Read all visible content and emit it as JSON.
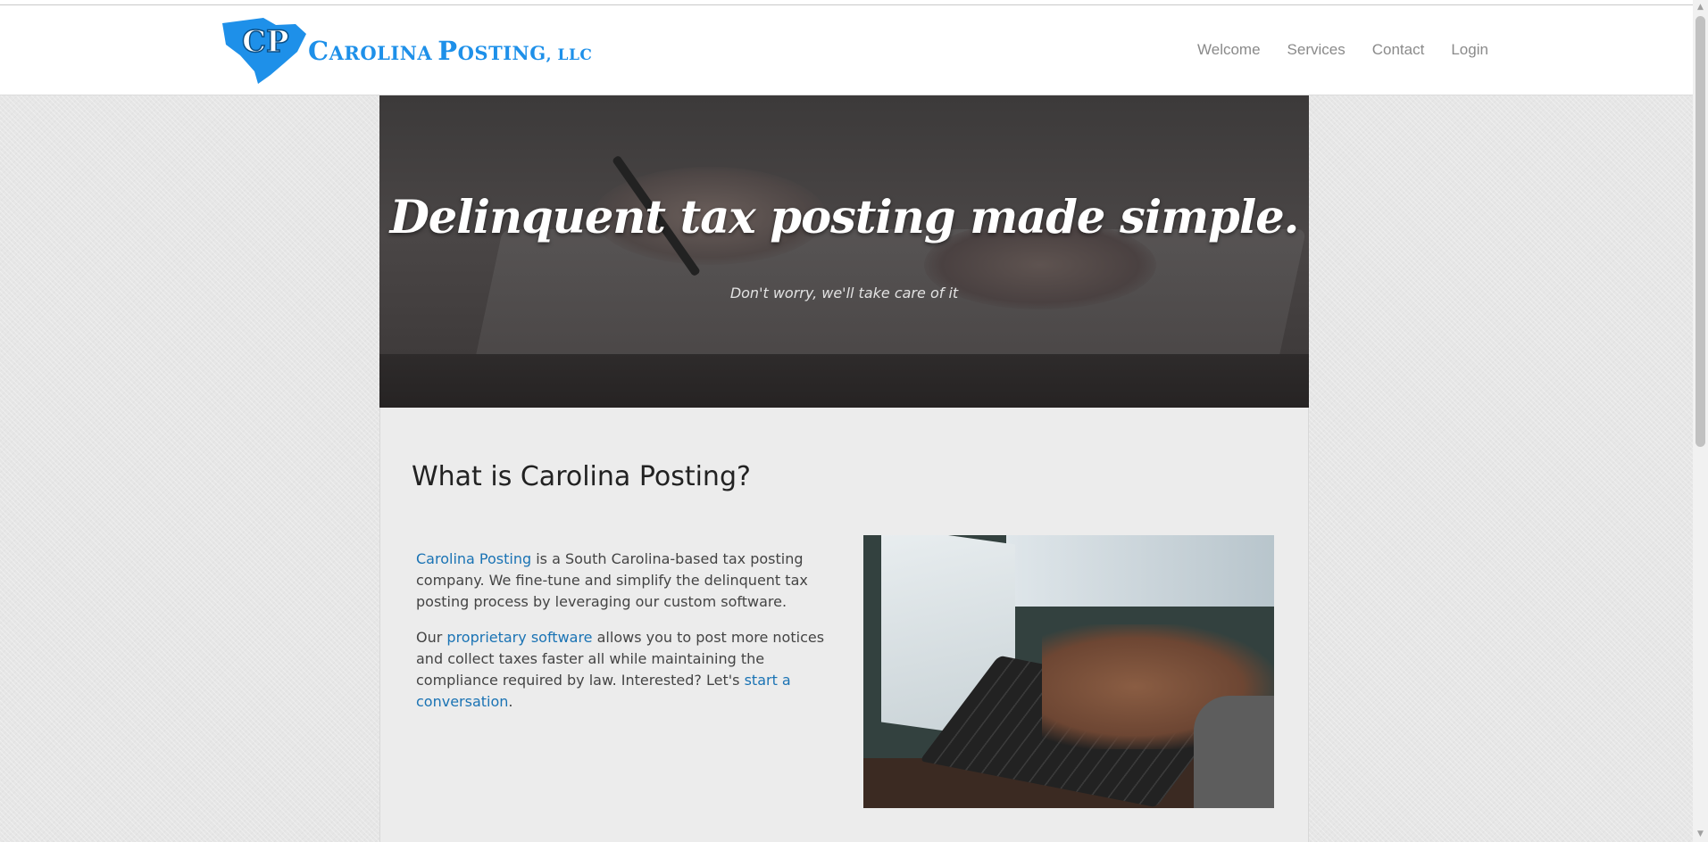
{
  "header": {
    "logo_initials": "CP",
    "logo_big_c": "C",
    "logo_word1": "AROLINA",
    "logo_big_p": "P",
    "logo_word2": "OSTING",
    "logo_llc": ", LLC",
    "nav": [
      {
        "label": "Welcome"
      },
      {
        "label": "Services"
      },
      {
        "label": "Contact"
      },
      {
        "label": "Login"
      }
    ]
  },
  "hero": {
    "title": "Delinquent tax posting made simple.",
    "subtitle": "Don't worry, we'll take care of it"
  },
  "about": {
    "heading": "What is Carolina Posting?",
    "p1_link": "Carolina Posting",
    "p1_text": " is a South Carolina-based tax posting company. We fine-tune and simplify the delinquent tax posting process by leveraging our custom software.",
    "p2_pre": "Our ",
    "p2_link": "proprietary software",
    "p2_mid": " allows you to post more notices and collect taxes faster all while maintaining the compliance required by law. Interested? Let's ",
    "p2_link2": "start a conversation",
    "p2_end": "."
  },
  "colors": {
    "brand_blue": "#1e90e9",
    "link_blue": "#1a73b4",
    "nav_gray": "#8a8a8a"
  },
  "icons": {
    "logo": "south-carolina-state-shape-icon",
    "scroll_up": "chevron-up-icon",
    "scroll_down": "chevron-down-icon"
  }
}
